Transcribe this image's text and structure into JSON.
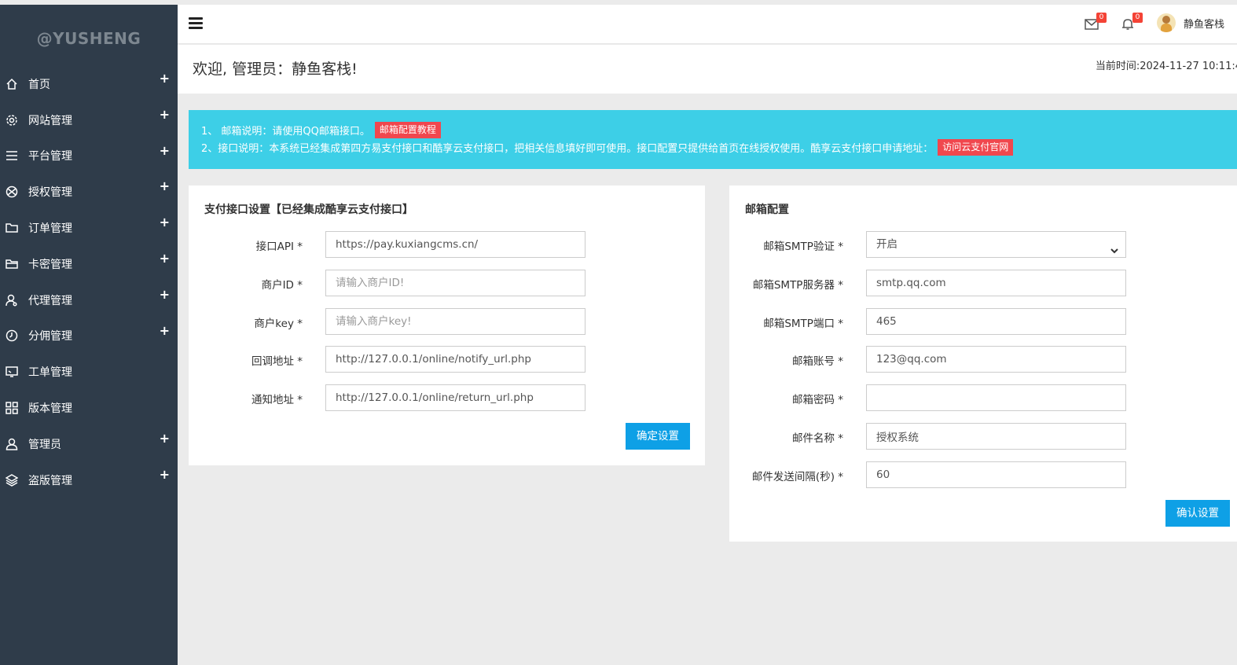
{
  "sidebar": {
    "logo": "@YUSHENG",
    "items": [
      {
        "label": "首页",
        "icon": "home-icon",
        "expand": "+"
      },
      {
        "label": "网站管理",
        "icon": "gear-icon",
        "expand": "+"
      },
      {
        "label": "平台管理",
        "icon": "list-icon",
        "expand": "+"
      },
      {
        "label": "授权管理",
        "icon": "ball-icon",
        "expand": "+"
      },
      {
        "label": "订单管理",
        "icon": "folder-icon",
        "expand": "+"
      },
      {
        "label": "卡密管理",
        "icon": "folder-open-icon",
        "expand": "+"
      },
      {
        "label": "代理管理",
        "icon": "user-search-icon",
        "expand": "+"
      },
      {
        "label": "分佣管理",
        "icon": "clock-icon",
        "expand": "+"
      },
      {
        "label": "工单管理",
        "icon": "monitor-icon",
        "expand": ""
      },
      {
        "label": "版本管理",
        "icon": "grid-icon",
        "expand": ""
      },
      {
        "label": "管理员",
        "icon": "user-icon",
        "expand": "+"
      },
      {
        "label": "盗版管理",
        "icon": "layers-icon",
        "expand": "+"
      }
    ]
  },
  "topbar": {
    "mail_count": "0",
    "bell_count": "0",
    "user_name": "静鱼客栈"
  },
  "welcome": {
    "title": "欢迎, 管理员：静鱼客栈!",
    "time": "当前时间:2024-11-27 10:11:4"
  },
  "notice": {
    "line1": "1、 邮箱说明：请使用QQ邮箱接口。",
    "line1_button": "邮箱配置教程",
    "line2": "2、接口说明：本系统已经集成第四方易支付接口和酷享云支付接口，把相关信息填好即可使用。接口配置只提供给首页在线授权使用。酷享云支付接口申请地址：",
    "line2_button": "访问云支付官网"
  },
  "payment": {
    "title": "支付接口设置【已经集成酷享云支付接口】",
    "fields": [
      {
        "label": "接口API *",
        "value": "https://pay.kuxiangcms.cn/",
        "placeholder": ""
      },
      {
        "label": "商户ID *",
        "value": "",
        "placeholder": "请输入商户ID!"
      },
      {
        "label": "商户key *",
        "value": "",
        "placeholder": "请输入商户key!"
      },
      {
        "label": "回调地址 *",
        "value": "http://127.0.0.1/online/notify_url.php",
        "placeholder": ""
      },
      {
        "label": "通知地址 *",
        "value": "http://127.0.0.1/online/return_url.php",
        "placeholder": ""
      }
    ],
    "submit": "确定设置"
  },
  "mail": {
    "title": "邮箱配置",
    "fields": [
      {
        "label": "邮箱SMTP验证 *",
        "value": "开启",
        "type": "select"
      },
      {
        "label": "邮箱SMTP服务器 *",
        "value": "smtp.qq.com",
        "type": "input"
      },
      {
        "label": "邮箱SMTP端口 *",
        "value": "465",
        "type": "input"
      },
      {
        "label": "邮箱账号 *",
        "value": "123@qq.com",
        "type": "input"
      },
      {
        "label": "邮箱密码 *",
        "value": "",
        "type": "input"
      },
      {
        "label": "邮件名称 *",
        "value": "授权系统",
        "type": "input"
      },
      {
        "label": "邮件发送间隔(秒) *",
        "value": "60",
        "type": "input"
      }
    ],
    "submit": "确认设置"
  }
}
